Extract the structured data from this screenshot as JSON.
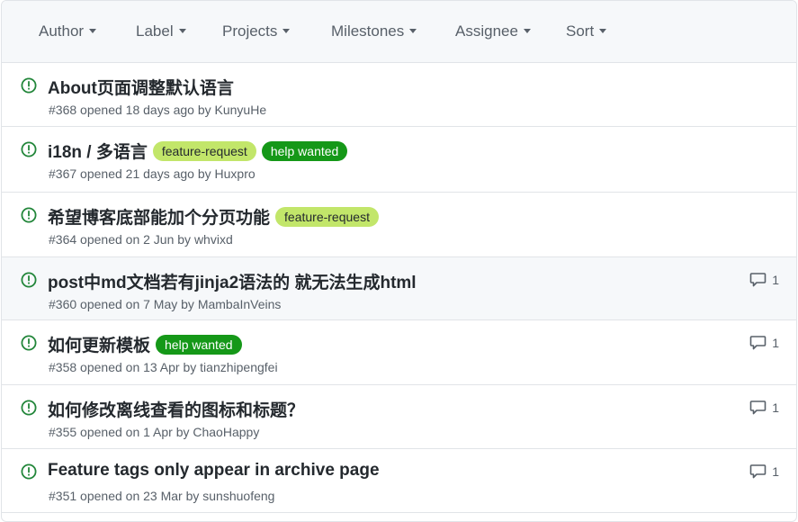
{
  "filters": [
    {
      "label": "Author"
    },
    {
      "label": "Label"
    },
    {
      "label": "Projects"
    },
    {
      "label": "Milestones"
    },
    {
      "label": "Assignee"
    },
    {
      "label": "Sort"
    }
  ],
  "colors": {
    "open_icon": "#22863a",
    "feature_request_bg": "#c2e66a",
    "feature_request_fg": "#24292e",
    "help_wanted_bg": "#159818",
    "help_wanted_fg": "#ffffff"
  },
  "issues": [
    {
      "title": "About页面调整默认语言",
      "labels": [],
      "number": "#368",
      "opened": "opened 18 days ago by",
      "author": "KunyuHe",
      "comments": ""
    },
    {
      "title": "i18n / 多语言",
      "labels": [
        "feature-request",
        "help wanted"
      ],
      "number": "#367",
      "opened": "opened 21 days ago by",
      "author": "Huxpro",
      "comments": ""
    },
    {
      "title": "希望博客底部能加个分页功能",
      "labels": [
        "feature-request"
      ],
      "number": "#364",
      "opened": "opened on 2 Jun by",
      "author": "whvixd",
      "comments": ""
    },
    {
      "title": "post中md文档若有jinja2语法的 就无法生成html",
      "labels": [],
      "number": "#360",
      "opened": "opened on 7 May by",
      "author": "MambaInVeins",
      "comments": "1"
    },
    {
      "title": "如何更新模板",
      "labels": [
        "help wanted"
      ],
      "number": "#358",
      "opened": "opened on 13 Apr by",
      "author": "tianzhipengfei",
      "comments": "1"
    },
    {
      "title": "如何修改离线查看的图标和标题？",
      "labels": [],
      "number": "#355",
      "opened": "opened on 1 Apr by",
      "author": "ChaoHappy",
      "comments": "1"
    },
    {
      "title": "Feature tags only appear in archive page",
      "labels": [],
      "number": "#351",
      "opened": "opened on 23 Mar by",
      "author": "sunshuofeng",
      "comments": "1"
    }
  ]
}
